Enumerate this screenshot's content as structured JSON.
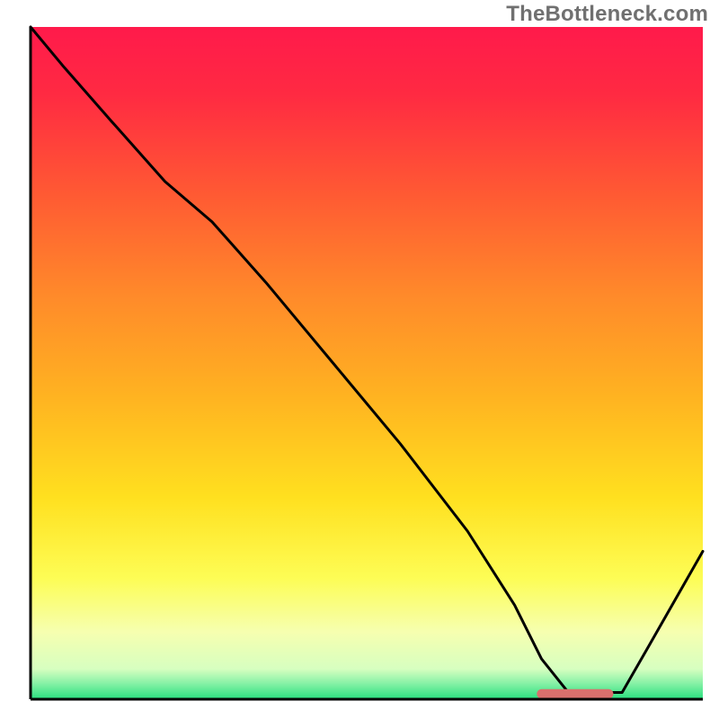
{
  "watermark": "TheBottleneck.com",
  "chart_data": {
    "type": "line",
    "title": "",
    "xlabel": "",
    "ylabel": "",
    "xlim": [
      0,
      100
    ],
    "ylim": [
      0,
      100
    ],
    "grid": false,
    "legend": false,
    "gradient_stops": [
      {
        "offset": 0.0,
        "color": "#ff1a4b"
      },
      {
        "offset": 0.1,
        "color": "#ff2a42"
      },
      {
        "offset": 0.25,
        "color": "#ff5a33"
      },
      {
        "offset": 0.4,
        "color": "#ff8a2a"
      },
      {
        "offset": 0.55,
        "color": "#ffb321"
      },
      {
        "offset": 0.7,
        "color": "#ffe01f"
      },
      {
        "offset": 0.82,
        "color": "#fdfd55"
      },
      {
        "offset": 0.9,
        "color": "#f6ffb0"
      },
      {
        "offset": 0.955,
        "color": "#d7ffc0"
      },
      {
        "offset": 0.975,
        "color": "#8cf2a8"
      },
      {
        "offset": 1.0,
        "color": "#29e07f"
      }
    ],
    "series": [
      {
        "name": "bottleneck-curve",
        "color": "#000000",
        "x": [
          0,
          5,
          12,
          20,
          27,
          35,
          45,
          55,
          65,
          72,
          76,
          80,
          84,
          88,
          92,
          100
        ],
        "y": [
          100,
          94,
          86,
          77,
          71,
          62,
          50,
          38,
          25,
          14,
          6,
          1,
          1,
          1,
          8,
          22
        ]
      }
    ],
    "flat_segment": {
      "color": "#d9706d",
      "x_start": 76,
      "x_end": 86,
      "y": 0.8,
      "thickness": 1.4
    }
  }
}
